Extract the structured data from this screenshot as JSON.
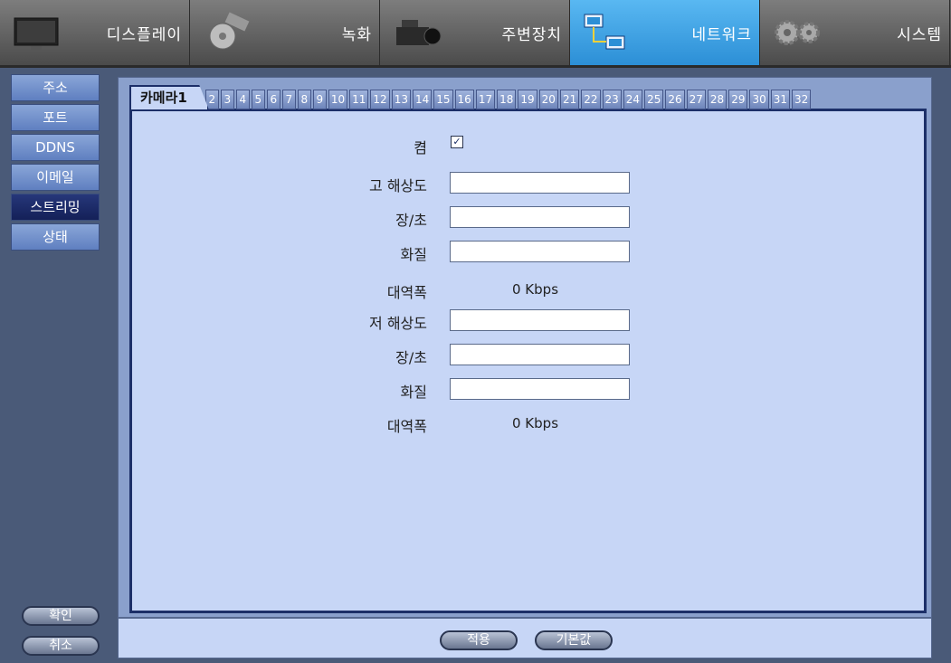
{
  "top_tabs": [
    {
      "label": "디스플레이",
      "icon": "monitor-icon"
    },
    {
      "label": "녹화",
      "icon": "film-reel-icon"
    },
    {
      "label": "주변장치",
      "icon": "camcorder-icon"
    },
    {
      "label": "네트워크",
      "icon": "network-icon",
      "active": true
    },
    {
      "label": "시스템",
      "icon": "gears-icon"
    }
  ],
  "sidebar": {
    "items": [
      "주소",
      "포트",
      "DDNS",
      "이메일",
      "스트리밍",
      "상태"
    ],
    "active": "스트리밍",
    "ok_label": "확인",
    "cancel_label": "취소"
  },
  "camera_tabs": {
    "first": "카메라1",
    "numbers": [
      "2",
      "3",
      "4",
      "5",
      "6",
      "7",
      "8",
      "9",
      "10",
      "11",
      "12",
      "13",
      "14",
      "15",
      "16",
      "17",
      "18",
      "19",
      "20",
      "21",
      "22",
      "23",
      "24",
      "25",
      "26",
      "27",
      "28",
      "29",
      "30",
      "31",
      "32"
    ]
  },
  "form": {
    "enable_label": "켬",
    "enable_checked": true,
    "high_res_label": "고 해상도",
    "high_fps_label": "장/초",
    "high_quality_label": "화질",
    "high_bandwidth_label": "대역폭",
    "high_bandwidth_value": "0 Kbps",
    "low_res_label": "저 해상도",
    "low_fps_label": "장/초",
    "low_quality_label": "화질",
    "low_bandwidth_label": "대역폭",
    "low_bandwidth_value": "0 Kbps"
  },
  "buttons": {
    "apply_label": "적용",
    "default_label": "기본값"
  },
  "colors": {
    "active_tab": "#2c8fd6",
    "active_nav": "#142058",
    "panel_bg": "#c7d6f6"
  }
}
